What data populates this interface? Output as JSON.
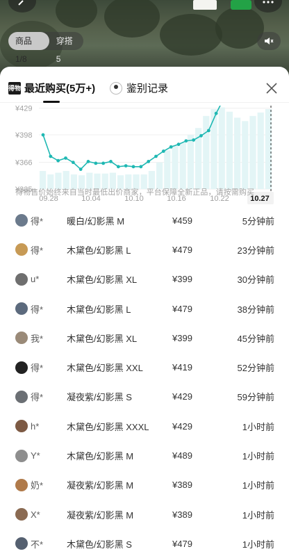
{
  "header": {
    "pill_tabs": [
      "商品1/8",
      "穿搭5"
    ],
    "active_pill": 0
  },
  "sheet": {
    "tabs": [
      {
        "logo": "得物",
        "label": "最近购买(5万+)"
      },
      {
        "label": "鉴别记录"
      }
    ],
    "close_icon": "close-icon"
  },
  "chart_data": {
    "type": "line",
    "y_tick_labels": [
      "¥429",
      "¥398",
      "¥366",
      "¥335"
    ],
    "y_ticks": [
      429,
      398,
      366,
      335
    ],
    "x_tick_labels": [
      "09.28",
      "10.04",
      "10.10",
      "10.16",
      "10.22",
      "10.27"
    ],
    "highlight_label": "10.27",
    "ylim": [
      335,
      432
    ],
    "series": [
      {
        "values": [
          398,
          373,
          368,
          371,
          366,
          358,
          367,
          365,
          365,
          367,
          361,
          362,
          361,
          361,
          367,
          373,
          379,
          384,
          387,
          391,
          392,
          397,
          403,
          423,
          440
        ]
      }
    ],
    "bars": [
      356,
      352,
      354,
      356,
      352,
      351,
      354,
      353,
      353,
      354,
      351,
      352,
      352,
      352,
      356,
      366,
      380,
      385,
      389,
      398,
      406,
      420,
      428,
      430,
      425,
      418,
      414,
      420,
      424,
      428
    ]
  },
  "disclaimer": "得物售价始终来自当时最低出价商家，平台保障全新正品，请按需购买",
  "records": [
    {
      "name": "得*",
      "spec": "暖白/幻影黑 M",
      "price": "¥459",
      "time": "5分钟前",
      "avatar_color": "#6b7a8c"
    },
    {
      "name": "得*",
      "spec": "木黛色/幻影黑 L",
      "price": "¥479",
      "time": "23分钟前",
      "avatar_color": "#c79a55"
    },
    {
      "name": "u*",
      "spec": "木黛色/幻影黑 XL",
      "price": "¥399",
      "time": "30分钟前",
      "avatar_color": "#6f6f6f"
    },
    {
      "name": "得*",
      "spec": "木黛色/幻影黑 L",
      "price": "¥479",
      "time": "38分钟前",
      "avatar_color": "#5c6a7d"
    },
    {
      "name": "我*",
      "spec": "木黛色/幻影黑 XL",
      "price": "¥399",
      "time": "45分钟前",
      "avatar_color": "#9a8a78"
    },
    {
      "name": "得*",
      "spec": "木黛色/幻影黑 XXL",
      "price": "¥419",
      "time": "52分钟前",
      "avatar_color": "#222222"
    },
    {
      "name": "得*",
      "spec": "凝夜紫/幻影黑 S",
      "price": "¥429",
      "time": "59分钟前",
      "avatar_color": "#6b6f74"
    },
    {
      "name": "h*",
      "spec": "木黛色/幻影黑 XXXL",
      "price": "¥429",
      "time": "1小时前",
      "avatar_color": "#7d5a44"
    },
    {
      "name": "Y*",
      "spec": "木黛色/幻影黑 M",
      "price": "¥489",
      "time": "1小时前",
      "avatar_color": "#8e8e8e"
    },
    {
      "name": "奶*",
      "spec": "凝夜紫/幻影黑 M",
      "price": "¥389",
      "time": "1小时前",
      "avatar_color": "#b07a4a"
    },
    {
      "name": "X*",
      "spec": "凝夜紫/幻影黑 M",
      "price": "¥389",
      "time": "1小时前",
      "avatar_color": "#8a6a52"
    },
    {
      "name": "不*",
      "spec": "木黛色/幻影黑 S",
      "price": "¥479",
      "time": "1小时前",
      "avatar_color": "#556070"
    }
  ],
  "colors": {
    "line": "#1fb8b3",
    "bars": "#e3f5f6",
    "grid": "#efefef",
    "axis_text": "#a0a0a0",
    "highlight_bg": "#f2f2f2"
  }
}
